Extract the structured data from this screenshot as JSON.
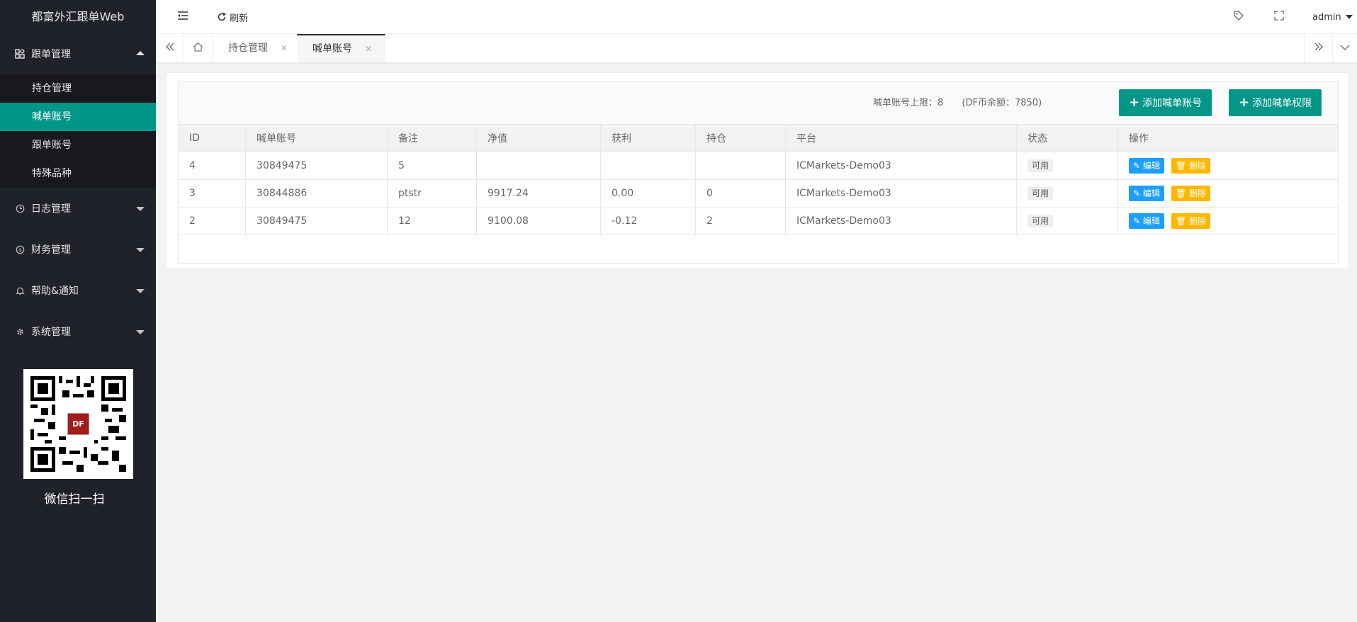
{
  "app": {
    "title": "都富外汇跟单Web"
  },
  "header": {
    "refresh_label": "刷新",
    "user": "admin"
  },
  "sidebar": {
    "groups": [
      {
        "label": "跟单管理",
        "items": [
          {
            "label": "持仓管理"
          },
          {
            "label": "喊单账号"
          },
          {
            "label": "跟单账号"
          },
          {
            "label": "特殊品种"
          }
        ]
      },
      {
        "label": "日志管理"
      },
      {
        "label": "财务管理"
      },
      {
        "label": "帮助&通知"
      },
      {
        "label": "系统管理"
      }
    ],
    "qr_caption": "微信扫一扫",
    "qr_logo_text": "DF"
  },
  "tabs": [
    {
      "label": "持仓管理"
    },
    {
      "label": "喊单账号"
    }
  ],
  "toolbar": {
    "limit_text": "喊单账号上限：8",
    "balance_text": "(DF币余额：7850)",
    "add_account_label": "添加喊单账号",
    "add_permission_label": "添加喊单权限"
  },
  "table": {
    "columns": [
      "ID",
      "喊单账号",
      "备注",
      "净值",
      "获利",
      "持仓",
      "平台",
      "状态",
      "操作"
    ],
    "rows": [
      {
        "id": "4",
        "account": "30849475",
        "remark": "5",
        "equity": "",
        "profit": "",
        "position": "",
        "platform": "ICMarkets-Demo03",
        "status": "可用"
      },
      {
        "id": "3",
        "account": "30844886",
        "remark": "ptstr",
        "equity": "9917.24",
        "profit": "0.00",
        "position": "0",
        "platform": "ICMarkets-Demo03",
        "status": "可用"
      },
      {
        "id": "2",
        "account": "30849475",
        "remark": "12",
        "equity": "9100.08",
        "profit": "-0.12",
        "position": "2",
        "platform": "ICMarkets-Demo03",
        "status": "可用"
      }
    ],
    "edit_label": "编辑",
    "delete_label": "删除"
  },
  "colors": {
    "sidebar_bg": "#20222a",
    "accent": "#009688",
    "edit": "#1e9fff",
    "delete": "#ffb800"
  }
}
